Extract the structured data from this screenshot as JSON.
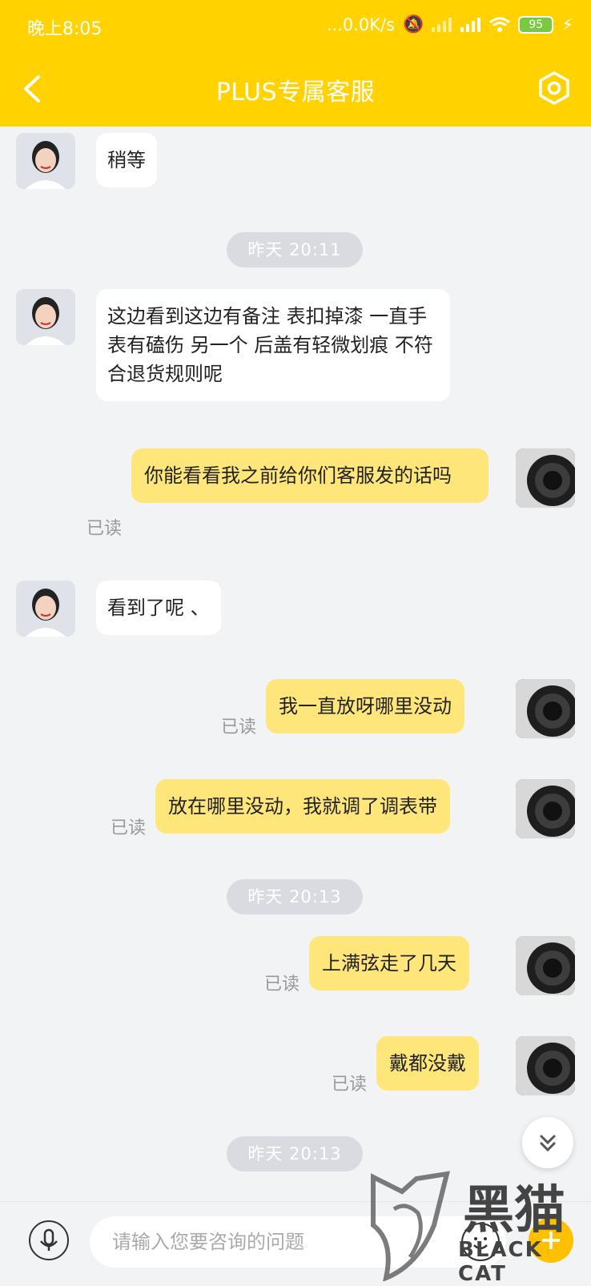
{
  "status_bar": {
    "time": "晚上8:05",
    "network_speed": "...0.0K/s",
    "battery": "95"
  },
  "header": {
    "title": "PLUS专属客服"
  },
  "messages": [
    {
      "side": "agent",
      "text": "稍等"
    },
    {
      "side": "time",
      "text": "昨天  20:11"
    },
    {
      "side": "agent",
      "text": "这边看到这边有备注    表扣掉漆  一直手表有磕伤    另一个  后盖有轻微划痕    不符合退货规则呢"
    },
    {
      "side": "user",
      "text": "你能看看我之前给你们客服发的话吗",
      "status": "已读"
    },
    {
      "side": "agent",
      "text": "看到了呢  、"
    },
    {
      "side": "user",
      "text": "我一直放呀哪里没动",
      "status": "已读"
    },
    {
      "side": "user",
      "text": "放在哪里没动，我就调了调表带",
      "status": "已读"
    },
    {
      "side": "time",
      "text": "昨天  20:13"
    },
    {
      "side": "user",
      "text": "上满弦走了几天",
      "status": "已读"
    },
    {
      "side": "user",
      "text": "戴都没戴",
      "status": "已读"
    },
    {
      "side": "time",
      "text": "昨天  20:13"
    }
  ],
  "input": {
    "placeholder": "请输入您要咨询的问题"
  },
  "watermark": {
    "text": "黑猫",
    "sub": "BLACK CAT"
  },
  "colors": {
    "brand_yellow": "#ffd200",
    "user_bubble": "#ffe67a",
    "background": "#f2f3f5"
  }
}
